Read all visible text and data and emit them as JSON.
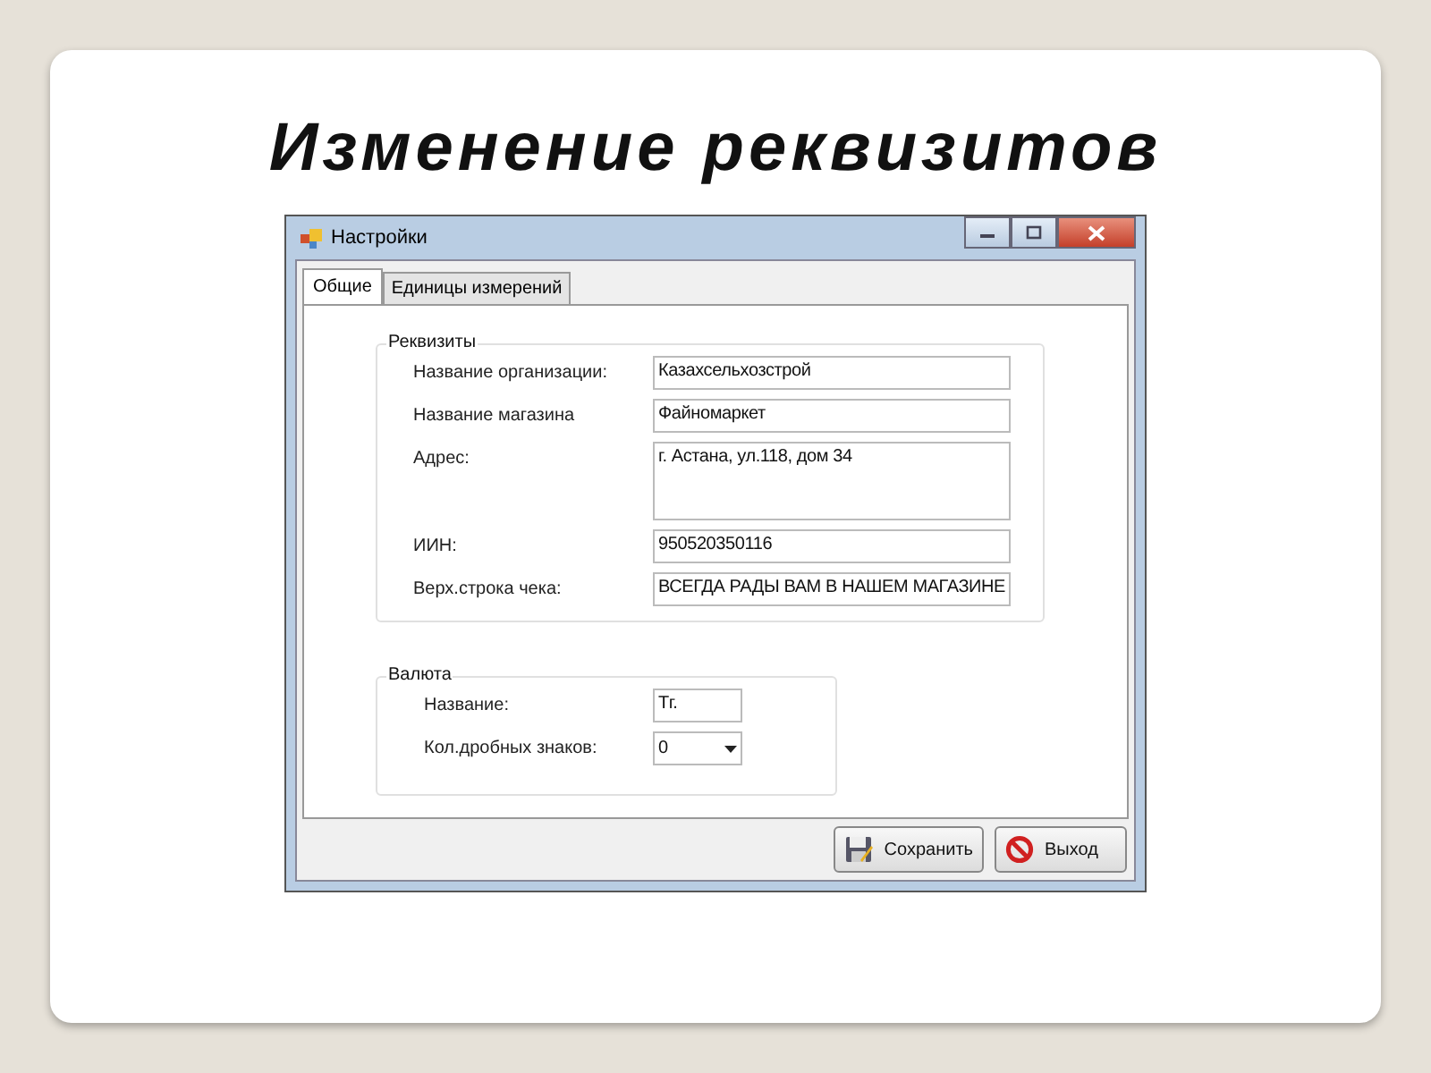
{
  "slide_title": "Изменение реквизитов",
  "window": {
    "title": "Настройки"
  },
  "tabs": [
    {
      "label": "Общие",
      "selected": true
    },
    {
      "label": "Единицы измерений",
      "selected": false
    }
  ],
  "groups": [
    {
      "title": "Реквизиты",
      "fields": [
        {
          "label": "Название организации:",
          "kind": "text",
          "value": "Казахсельхозстрой"
        },
        {
          "label": "Название магазина",
          "kind": "text",
          "value": "Файномаркет"
        },
        {
          "label": "Адрес:",
          "kind": "multiline",
          "value": "г. Астана, ул.118, дом 34"
        },
        {
          "label": "ИИН:",
          "kind": "text",
          "value": "950520350116"
        },
        {
          "label": "Верх.строка чека:",
          "kind": "text",
          "value": "ВСЕГДА РАДЫ ВАМ В НАШЕМ МАГАЗИНЕ"
        }
      ]
    },
    {
      "title": "Валюта",
      "fields": [
        {
          "label": "Название:",
          "kind": "text",
          "value": "Тг."
        },
        {
          "label": "Кол.дробных знаков:",
          "kind": "combo",
          "value": "0"
        }
      ]
    }
  ],
  "buttons": [
    {
      "label": "Сохранить",
      "kind": "save"
    },
    {
      "label": "Выход",
      "kind": "exit"
    }
  ]
}
